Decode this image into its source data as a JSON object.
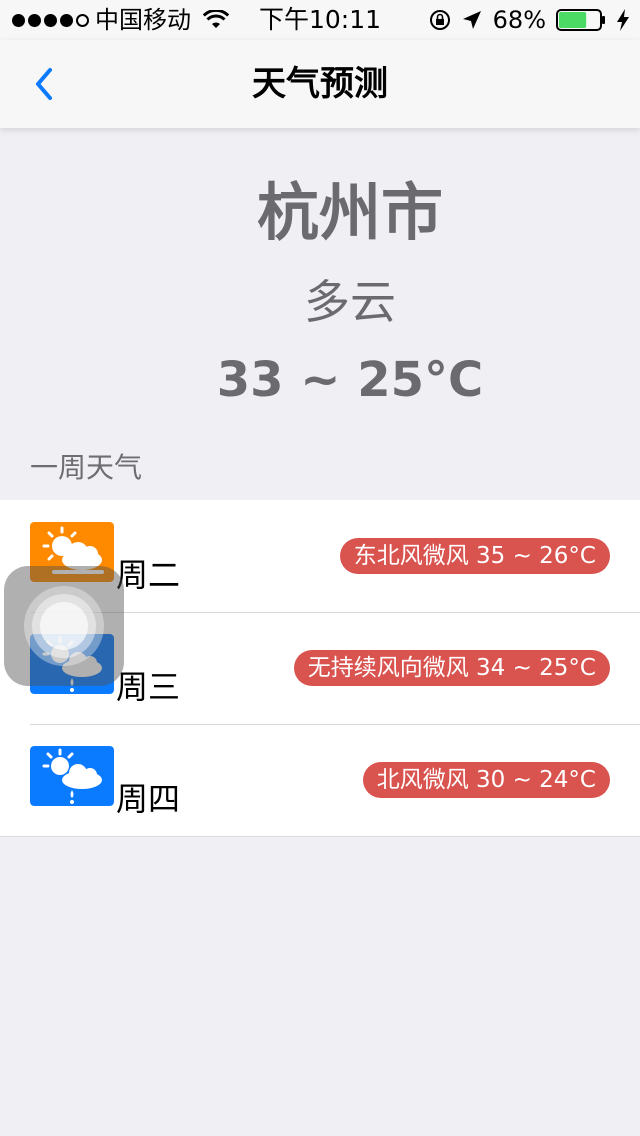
{
  "status_bar": {
    "carrier": "中国移动",
    "time": "下午10:11",
    "battery": "68%",
    "battery_level": 0.68,
    "signal_bars_filled": 4,
    "signal_bars_total": 5
  },
  "nav": {
    "title": "天气预测"
  },
  "header": {
    "city": "杭州市",
    "weather": "多云",
    "temperature": "33 ~ 25°C"
  },
  "section": {
    "title": "一周天气"
  },
  "forecast": [
    {
      "day": "周二",
      "detail": "东北风微风 35 ~ 26°C",
      "icon": "partly-sunny-icon",
      "icon_color": "#ff8a00"
    },
    {
      "day": "周三",
      "detail": "无持续风向微风 34 ~ 25°C",
      "icon": "sun-rain-icon",
      "icon_color": "#0a7aff"
    },
    {
      "day": "周四",
      "detail": "北风微风 30 ~ 24°C",
      "icon": "sun-rain-icon",
      "icon_color": "#0a7aff"
    }
  ],
  "colors": {
    "accent": "#0a7aff",
    "badge": "#d9534f",
    "background": "#efeff4",
    "muted_text": "#6b6b6f"
  }
}
